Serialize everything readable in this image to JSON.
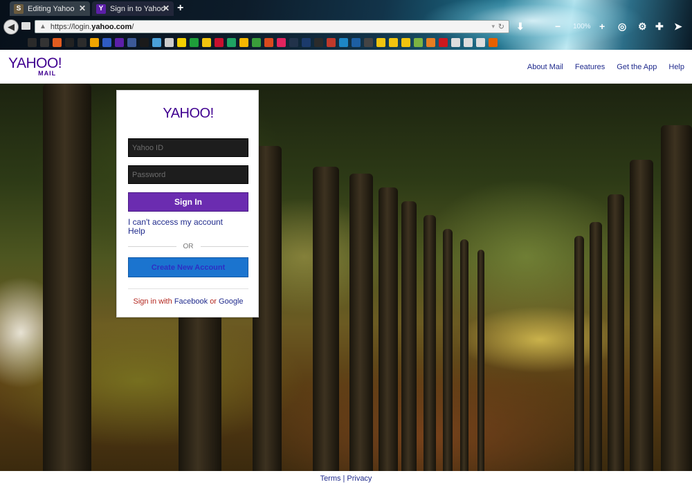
{
  "browser": {
    "tabs": [
      {
        "label": "Editing Yahoo",
        "icon": "s-favicon-icon"
      },
      {
        "label": "Sign in to Yahoo",
        "icon": "yahoo-favicon-icon"
      }
    ],
    "new_tab": "+",
    "url_prefix": "https://login.",
    "url_host": "yahoo.com",
    "url_suffix": "/",
    "zoom": "100%"
  },
  "header": {
    "logo_text": "YAHOO!",
    "logo_sub": "MAIL",
    "nav": [
      "About Mail",
      "Features",
      "Get the App",
      "Help"
    ]
  },
  "login": {
    "logo_text": "YAHOO!",
    "yahoo_id_placeholder": "Yahoo ID",
    "password_placeholder": "Password",
    "signin_label": "Sign In",
    "cant_access_label": "I can't access my account",
    "help_label": "Help",
    "or_label": "OR",
    "create_label": "Create New Account",
    "social_prefix": "Sign in with",
    "facebook_label": "Facebook",
    "or_word": "or",
    "google_label": "Google"
  },
  "footer": {
    "terms_label": "Terms",
    "separator": "|",
    "privacy_label": "Privacy"
  },
  "colors": {
    "brand_purple": "#400090",
    "signin_purple": "#6b2cb0",
    "create_blue": "#1b74cf",
    "link_blue": "#1f2a8c"
  }
}
